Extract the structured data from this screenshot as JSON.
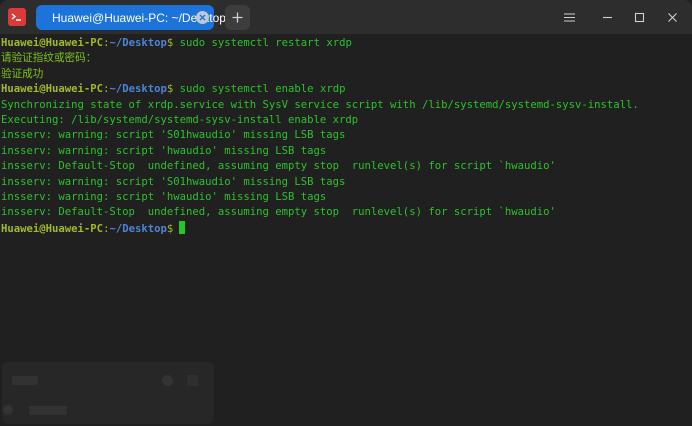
{
  "window": {
    "tab_title": "Huawei@Huawei-PC: ~/Desktop",
    "icons": {
      "app": "terminal-app-icon",
      "tab_close": "close-icon",
      "new_tab": "plus-icon",
      "menu": "hamburger-menu-icon",
      "minimize": "minimize-icon",
      "maximize": "maximize-icon",
      "close": "close-icon"
    }
  },
  "colors": {
    "accent": "#1c73d9",
    "prompt_user": "#a2b92a",
    "prompt_path": "#4d83d6",
    "output": "#2dc12d",
    "background": "#202020"
  },
  "terminal": {
    "lines": [
      {
        "kind": "prompt",
        "user": "Huawei@Huawei-PC",
        "path": "~/Desktop",
        "symbol": "$",
        "command": " sudo systemctl restart xrdp"
      },
      {
        "kind": "cjk",
        "text": "请验证指纹或密码："
      },
      {
        "kind": "cjk",
        "text": "验证成功"
      },
      {
        "kind": "prompt",
        "user": "Huawei@Huawei-PC",
        "path": "~/Desktop",
        "symbol": "$",
        "command": " sudo systemctl enable xrdp"
      },
      {
        "kind": "output",
        "text": "Synchronizing state of xrdp.service with SysV service script with /lib/systemd/systemd-sysv-install."
      },
      {
        "kind": "output",
        "text": "Executing: /lib/systemd/systemd-sysv-install enable xrdp"
      },
      {
        "kind": "output",
        "text": "insserv: warning: script 'S01hwaudio' missing LSB tags"
      },
      {
        "kind": "output",
        "text": "insserv: warning: script 'hwaudio' missing LSB tags"
      },
      {
        "kind": "output",
        "text": "insserv: Default-Stop  undefined, assuming empty stop  runlevel(s) for script `hwaudio'"
      },
      {
        "kind": "output",
        "text": "insserv: warning: script 'S01hwaudio' missing LSB tags"
      },
      {
        "kind": "output",
        "text": "insserv: warning: script 'hwaudio' missing LSB tags"
      },
      {
        "kind": "output",
        "text": "insserv: Default-Stop  undefined, assuming empty stop  runlevel(s) for script `hwaudio'"
      },
      {
        "kind": "prompt",
        "user": "Huawei@Huawei-PC",
        "path": "~/Desktop",
        "symbol": "$",
        "command": ""
      }
    ]
  }
}
